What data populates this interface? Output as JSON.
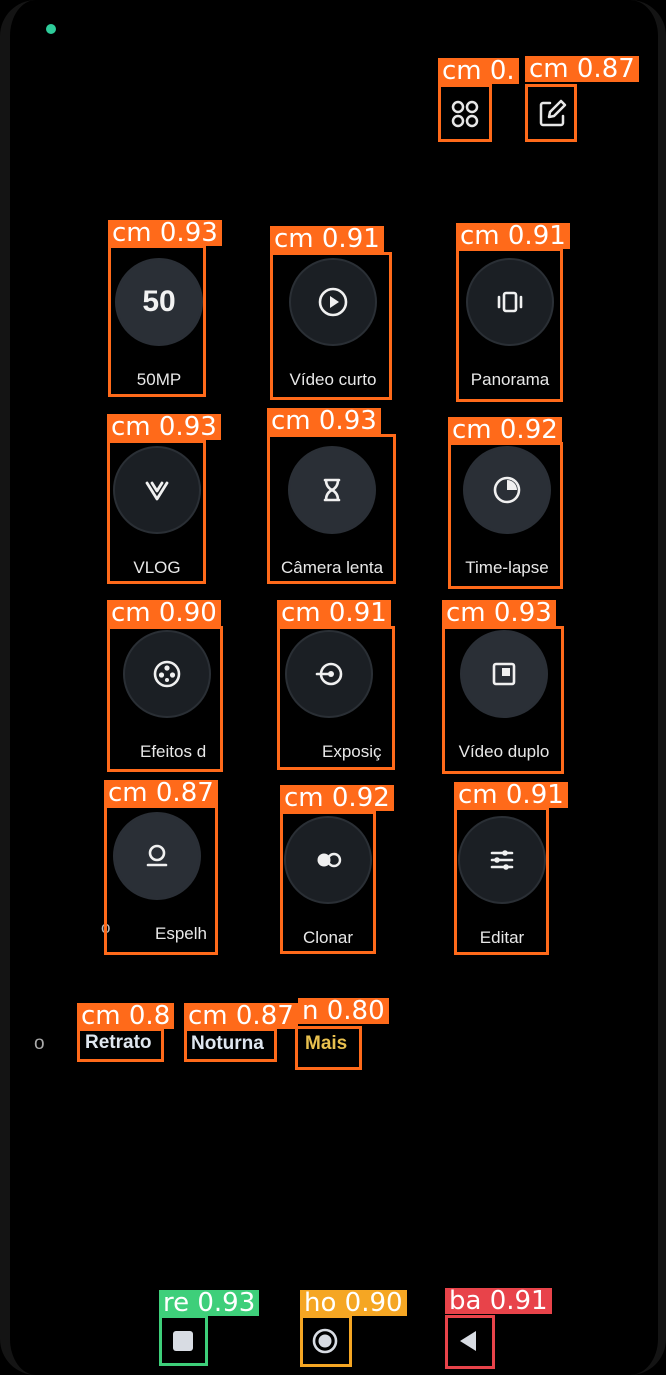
{
  "top_icons": [
    {
      "icon": "grid-icon",
      "det": "cm 0."
    },
    {
      "icon": "edit-icon",
      "det": "cm 0.87"
    }
  ],
  "modes": [
    {
      "label": "50MP",
      "icon_text": "50",
      "icon": "50mp-icon",
      "det": "cm 0.93"
    },
    {
      "label": "Vídeo curto",
      "icon": "play-circle-icon",
      "det": "cm 0.91"
    },
    {
      "label": "Panorama",
      "icon": "panorama-icon",
      "det": "cm 0.91"
    },
    {
      "label": "VLOG",
      "icon": "vlog-icon",
      "det": "cm 0.93"
    },
    {
      "label": "Câmera lenta",
      "icon": "hourglass-icon",
      "det": "cm 0.93"
    },
    {
      "label": "Time-lapse",
      "icon": "timelapse-icon",
      "det": "cm 0.92"
    },
    {
      "label": "Efeitos d",
      "icon": "film-reel-icon",
      "det": "cm 0.90"
    },
    {
      "label": "Exposiç",
      "icon": "exposure-icon",
      "det": "cm 0.91"
    },
    {
      "label": "Vídeo duplo",
      "icon": "dual-video-icon",
      "det": "cm 0.93"
    },
    {
      "label": "Espelh",
      "icon": "mirror-icon",
      "det": "cm 0.87"
    },
    {
      "label": "Clonar",
      "icon": "clone-icon",
      "det": "cm 0.92"
    },
    {
      "label": "Editar",
      "icon": "sliders-icon",
      "det": "cm 0.91"
    }
  ],
  "side_fragments": {
    "left_row4": "o",
    "left_tabs": "o"
  },
  "tabs": [
    {
      "label": "Retrato",
      "det": "cm 0.8"
    },
    {
      "label": "Noturna",
      "det": "cm 0.87"
    },
    {
      "label": "Mais",
      "det": "n 0.80",
      "active": true
    }
  ],
  "nav": [
    {
      "icon": "recents-icon",
      "det": "re 0.93",
      "color": "#3ecf7a"
    },
    {
      "icon": "home-icon",
      "det": "ho 0.90",
      "color": "#f5a623"
    },
    {
      "icon": "back-icon",
      "det": "ba 0.91",
      "color": "#e8434a"
    }
  ],
  "colors": {
    "det_box": "#ff6a1a",
    "active_tab": "#e8c04e",
    "status_dot": "#2ecc9a"
  }
}
